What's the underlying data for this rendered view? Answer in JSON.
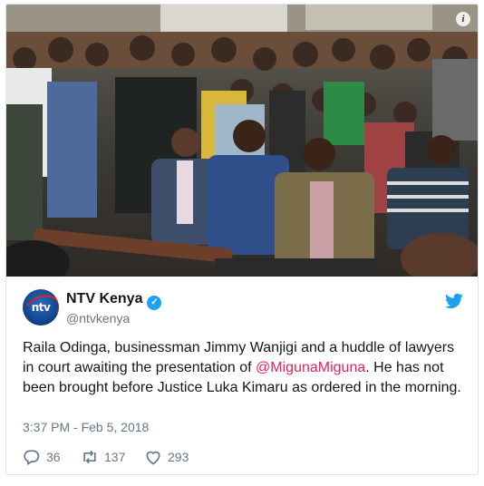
{
  "photo": {
    "alt_scene": "courtroom-crowd",
    "info_icon": "i"
  },
  "tweet": {
    "author_name": "NTV Kenya",
    "verified_mark": "✓",
    "handle": "@ntvkenya",
    "avatar_logo_text": "ntv",
    "body_before_mention": "Raila Odinga, businessman Jimmy Wanjigi and a huddle of lawyers in court awaiting the presentation of ",
    "mention": "@MigunaMiguna",
    "body_after_mention": ". He has not been brought before Justice Luka Kimaru  as ordered in the morning.",
    "timestamp": "3:37 PM - Feb 5, 2018",
    "replies": "36",
    "retweets": "137",
    "likes": "293"
  },
  "colors": {
    "mention": "#e0245e",
    "twitter_blue": "#1da1f2",
    "muted": "#657786"
  },
  "icons": [
    "info-icon",
    "twitter-bird-icon",
    "verified-icon",
    "reply-icon",
    "retweet-icon",
    "like-icon"
  ]
}
